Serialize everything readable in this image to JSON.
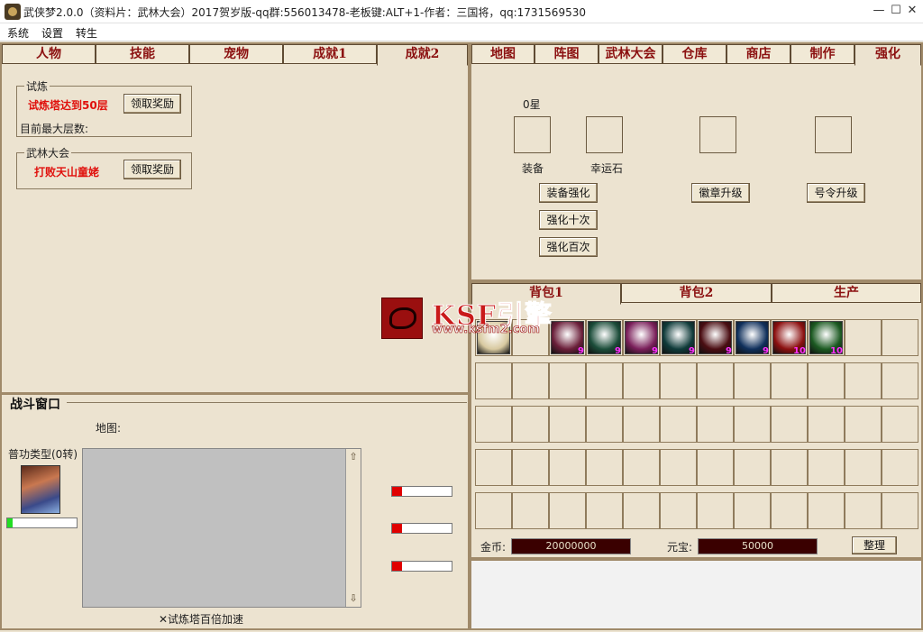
{
  "window": {
    "title": "武侠梦2.0.0（资料片：武林大会）2017贺岁版-qq群:556013478-老板键:ALT+1-作者：三国将，qq:1731569530",
    "minimize": "—",
    "maximize": "☐",
    "close": "✕"
  },
  "menu": [
    "系统",
    "设置",
    "转生"
  ],
  "left_tabs": [
    "人物",
    "技能",
    "宠物",
    "成就1",
    "成就2"
  ],
  "trial": {
    "group_title": "试炼",
    "goal": "试炼塔达到50层",
    "button": "领取奖励",
    "max_floor_label": "目前最大层数:"
  },
  "martial": {
    "group_title": "武林大会",
    "goal": "打败天山童姥",
    "button": "领取奖励"
  },
  "right_tabs": [
    "地图",
    "阵图",
    "武林大会",
    "仓库",
    "商店",
    "制作",
    "强化"
  ],
  "enhance": {
    "stars": "0星",
    "equip_label": "装备",
    "lucky_label": "幸运石",
    "enhance_button": "装备强化",
    "enhance10_button": "强化十次",
    "enhance100_button": "强化百次",
    "badge_button": "徽章升级",
    "command_button": "号令升级"
  },
  "watermark": {
    "brand": "KSF引擎",
    "url": "www.ksfm2.com"
  },
  "bag_tabs": [
    "背包1",
    "背包2",
    "生产"
  ],
  "bag_items": [
    {
      "icon": "sword-icon",
      "color": "#d8c9a0",
      "count": ""
    },
    {
      "icon": "empty",
      "color": "",
      "count": ""
    },
    {
      "icon": "white-crystal-icon",
      "color": "#6b1f3a",
      "count": "9"
    },
    {
      "icon": "green-crystal-icon",
      "color": "#1c4d3a",
      "count": "9"
    },
    {
      "icon": "pink-crystal-icon",
      "color": "#7a1f5a",
      "count": "9"
    },
    {
      "icon": "teal-gem-icon",
      "color": "#0f3b3a",
      "count": "9"
    },
    {
      "icon": "red-gem-icon",
      "color": "#4a0d12",
      "count": "9"
    },
    {
      "icon": "blue-crystal-icon",
      "color": "#10305c",
      "count": "9"
    },
    {
      "icon": "red-potion-icon",
      "color": "#8c1010",
      "count": "10"
    },
    {
      "icon": "green-potion-icon",
      "color": "#1c5a22",
      "count": "10"
    }
  ],
  "currency": {
    "gold_label": "金币:",
    "gold_value": "20000000",
    "ingot_label": "元宝:",
    "ingot_value": "50000",
    "sort_button": "整理"
  },
  "battle": {
    "title": "战斗窗口",
    "map_label": "地图:",
    "attack_type": "普功类型(0转)",
    "speedup_text": "✕试炼塔百倍加速",
    "player_progress": 0.08,
    "enemy_bars": [
      0.16,
      0.16,
      0.16
    ]
  },
  "colors": {
    "accent_red": "#e0100c",
    "tab_text": "#8b1010",
    "panel_bg": "#ece3d0"
  }
}
